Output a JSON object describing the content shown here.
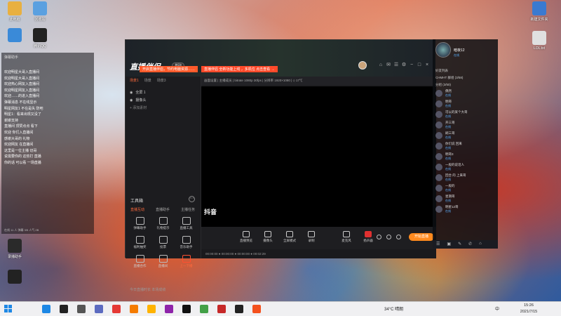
{
  "desktop": {
    "icons_left": [
      {
        "label": "此电脑",
        "color": "#e8b040"
      },
      {
        "label": "回收站",
        "color": "#5aa0e0"
      },
      {
        "label": "",
        "color": "#3a8ad8"
      },
      {
        "label": "腾讯QQ",
        "color": "#222"
      }
    ],
    "icons_right": [
      {
        "label": "新建文件夹",
        "color": "#3a7ad0"
      },
      {
        "label": "LOL.txt",
        "color": "#e0e0e0"
      }
    ],
    "bottom_left": [
      {
        "label": "录播助手",
        "color": "#2a2a2a"
      },
      {
        "label": "",
        "color": "#222"
      }
    ]
  },
  "chat_overlay": {
    "header": "弹幕助手",
    "lines": [
      "欢迎明星大哥入直播间",
      "欢迎明星大哥入直播间",
      "欢迎热心网友入直播间",
      "欢迎明星网友入直播间",
      "欢迎……的进入直播间",
      "弹幕消息 不在线显示",
      "明星网友1 不在是失 防吧",
      "明星1：看来出现又没了",
      "谢谢支持",
      "直播间 顶赞点点 看下",
      "欢迎 你们入直播间",
      "感谢大哥的 礼物",
      "欢迎网友 在直播间",
      "这里是一位主播 切哥",
      "说需要你的 这些打 直播",
      "你的话 可以看 一场直播"
    ],
    "footer": "在线 11 人 弹幕 3/5 人气 2B"
  },
  "app": {
    "brand": "直播伴侣",
    "brand_badge": "基础",
    "promos": [
      {
        "text": "开启直播伴侣，节约电脑资源……",
        "color": "#ff5a2a"
      },
      {
        "text": "直播伴侣 全新功能上线 ，多机位 点击查看 → ",
        "color": "#ff4a2a"
      }
    ],
    "scene_tabs": [
      "场景1",
      "场景",
      "场景3"
    ],
    "sources": [
      {
        "label": "全屏 1"
      },
      {
        "label": "摄像头"
      },
      {
        "label": "+ 添加素材"
      }
    ],
    "tools": {
      "title": "工具箱",
      "more": "⋯",
      "tabs": [
        "直播互动",
        "直播助手",
        "主播任务"
      ],
      "items": [
        {
          "label": "弹幕助手",
          "hot": false
        },
        {
          "label": "礼物提示",
          "hot": false
        },
        {
          "label": "直播工具",
          "hot": false
        },
        {
          "label": "福利抽奖",
          "hot": false
        },
        {
          "label": "投票",
          "hot": false
        },
        {
          "label": "音乐助手",
          "hot": false
        },
        {
          "label": "直播合作",
          "hot": false
        },
        {
          "label": "直播间",
          "hot": false
        },
        {
          "label": "上一下播",
          "hot": true
        }
      ]
    },
    "status_left": "今日直播时长 本场成绩",
    "stage_topbar": "画面设置  |  主播成员  |  bitrate 1080p 30fps  |  分辨率 1920×1080  |  ⬦ 17℃",
    "canvas_logo": "抖音",
    "controls": [
      {
        "label": "直播预览",
        "red": false
      },
      {
        "label": "摄像头",
        "red": false
      },
      {
        "label": "全屏模式",
        "red": false
      },
      {
        "label": "录制",
        "red": false
      },
      {
        "label": "麦克风",
        "red": false
      },
      {
        "label": "扬声器",
        "red": true
      }
    ],
    "go_live": "开始直播",
    "stage_status": "00:00:00  ●  00:00:00  ●  00:00:00  ●  00:02:29",
    "right_icons": [
      "⌂",
      "✉",
      "☰",
      "⚙",
      "−",
      "□",
      "×"
    ]
  },
  "qq": {
    "name": "暗夜12",
    "sub": "在线",
    "groups": [
      "好友列表",
      "CHMHT 群组 (3/58)",
      "分组 (3/50)"
    ],
    "members": [
      {
        "name": "偶然",
        "status": "在线"
      },
      {
        "name": "明哥",
        "status": "在线"
      },
      {
        "name": "可以的某个大哥",
        "status": "在线"
      },
      {
        "name": "开三哥",
        "status": "在线"
      },
      {
        "name": "刷三哥",
        "status": "在线"
      },
      {
        "name": "你们说 回来",
        "status": "在线"
      },
      {
        "name": "明哥3",
        "status": "在线"
      },
      {
        "name": "一般的说话人",
        "status": "在线"
      },
      {
        "name": "回合 的 上来哥",
        "status": "在线"
      },
      {
        "name": "一般的",
        "status": "在线"
      },
      {
        "name": "星期哥",
        "status": "在线"
      },
      {
        "name": "明星12哥",
        "status": "在线"
      }
    ],
    "bottom_icons": [
      "☰",
      "▣",
      "✎",
      "✆",
      "⌂"
    ]
  },
  "taskbar": {
    "icons": [
      {
        "color": "#1e88e5"
      },
      {
        "color": "#222"
      },
      {
        "color": "#555"
      },
      {
        "color": "#5c6bc0"
      },
      {
        "color": "#e53935"
      },
      {
        "color": "#f57c00"
      },
      {
        "color": "#ffb300"
      },
      {
        "color": "#8e24aa"
      },
      {
        "color": "#111"
      },
      {
        "color": "#43a047"
      },
      {
        "color": "#c62828"
      },
      {
        "color": "#222"
      },
      {
        "color": "#f4511e"
      }
    ],
    "weather": "34°C 晴朗",
    "ime": "中",
    "time": "15:26",
    "date": "2021/7/15"
  }
}
